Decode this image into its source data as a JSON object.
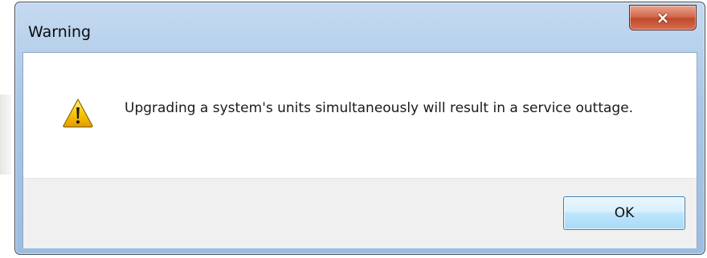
{
  "window": {
    "title": "Warning",
    "close_icon": "×"
  },
  "dialog": {
    "icon": "warning-icon",
    "message": "Upgrading a system's units simultaneously will result in a service outtage.",
    "ok_label": "OK"
  },
  "colors": {
    "title_bar": "#a9c6e6",
    "close_button": "#c04a2c",
    "footer": "#f0f0f0",
    "ok_button_border": "#3c7fb1",
    "warning_icon": "#f5c400"
  }
}
